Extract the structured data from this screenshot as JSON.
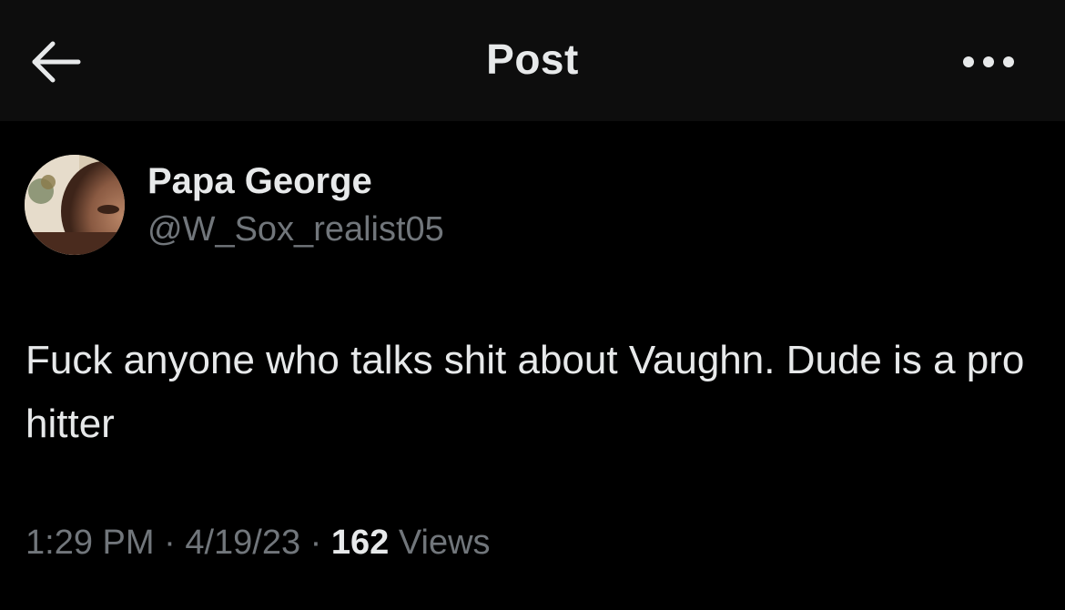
{
  "header": {
    "title": "Post",
    "back_icon": "arrow-left-icon",
    "more_icon": "more-horizontal-icon"
  },
  "post": {
    "display_name": "Papa George",
    "handle": "@W_Sox_realist05",
    "text": "Fuck anyone who talks shit about Vaughn. Dude is a pro hitter",
    "time": "1:29 PM",
    "date": "4/19/23",
    "separator": "·",
    "views_count": "162",
    "views_label": "Views"
  },
  "colors": {
    "background": "#000000",
    "header_background": "#0d0d0d",
    "primary_text": "#e7e9ea",
    "secondary_text": "#71767b"
  }
}
